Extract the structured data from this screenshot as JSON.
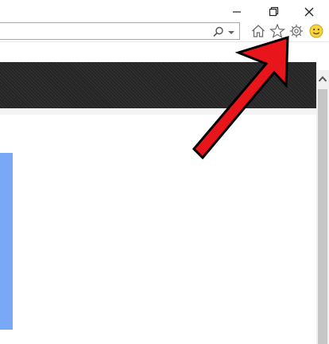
{
  "window": {
    "minimize_icon": "minimize-icon",
    "restore_icon": "restore-icon",
    "close_icon": "close-icon"
  },
  "address_bar": {
    "value": "",
    "search_icon": "search-icon",
    "dropdown_icon": "chevron-down-icon"
  },
  "toolbar": {
    "icons": [
      "home-icon",
      "star-icon",
      "gear-icon",
      "smiley-icon"
    ]
  },
  "annotation": {
    "arrow_color": "#e8161b",
    "points_to": "gear-icon"
  },
  "colors": {
    "dark_band": "#262626",
    "blue_bar": "#78a8f6",
    "scrollbar_thumb": "#c6c6c6"
  }
}
